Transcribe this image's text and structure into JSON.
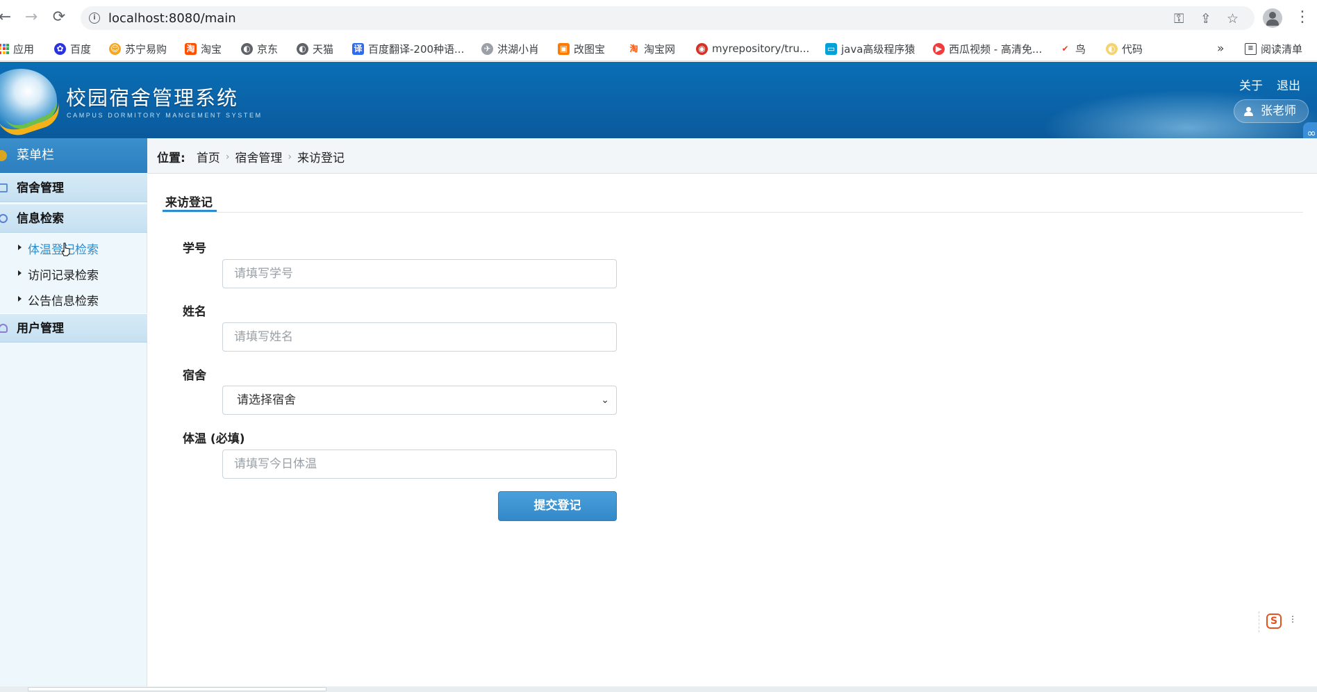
{
  "browser": {
    "url": "localhost:8080/main",
    "bookmarks": [
      {
        "label": "应用",
        "color": "#4285f4"
      },
      {
        "label": "百度",
        "color": "#2932e1"
      },
      {
        "label": "苏宁易购",
        "color": "#f5a623"
      },
      {
        "label": "淘宝",
        "color": "#ff5000"
      },
      {
        "label": "京东",
        "color": "#5f6368"
      },
      {
        "label": "天猫",
        "color": "#5f6368"
      },
      {
        "label": "百度翻译-200种语...",
        "color": "#2e6bf0"
      },
      {
        "label": "洪湖小肖",
        "color": "#8a8a8a"
      },
      {
        "label": "改图宝",
        "color": "#ff7a00"
      },
      {
        "label": "淘宝网",
        "color": "#ff5000"
      },
      {
        "label": "myrepository/tru...",
        "color": "#d93025"
      },
      {
        "label": "java高级程序猿",
        "color": "#00a1d6"
      },
      {
        "label": "西瓜视频 - 高清免...",
        "color": "#f03c3c"
      },
      {
        "label": "鸟",
        "color": "#e8412c"
      },
      {
        "label": "代码",
        "color": "#f6d36b"
      }
    ],
    "overflow": "»",
    "reading_list": "阅读清单"
  },
  "header": {
    "title": "校园宿舍管理系统",
    "subtitle": "CAMPUS DORMITORY MANGEMENT SYSTEM",
    "about": "关于",
    "logout": "退出",
    "user": "张老师"
  },
  "sidebar": {
    "title": "菜单栏",
    "groups": [
      {
        "label": "宿舍管理"
      },
      {
        "label": "信息检索",
        "items": [
          "体温登记检索",
          "访问记录检索",
          "公告信息检索"
        ]
      },
      {
        "label": "用户管理"
      }
    ]
  },
  "breadcrumb": {
    "label": "位置:",
    "items": [
      "首页",
      "宿舍管理",
      "来访登记"
    ]
  },
  "form": {
    "section_title": "来访登记",
    "student_id": {
      "label": "学号",
      "placeholder": "请填写学号"
    },
    "name": {
      "label": "姓名",
      "placeholder": "请填写姓名"
    },
    "dorm": {
      "label": "宿舍",
      "selected": "请选择宿舍"
    },
    "temperature": {
      "label": "体温 (必填)",
      "placeholder": "请填写今日体温"
    },
    "submit": "提交登记"
  },
  "ime": {
    "label": "S"
  }
}
